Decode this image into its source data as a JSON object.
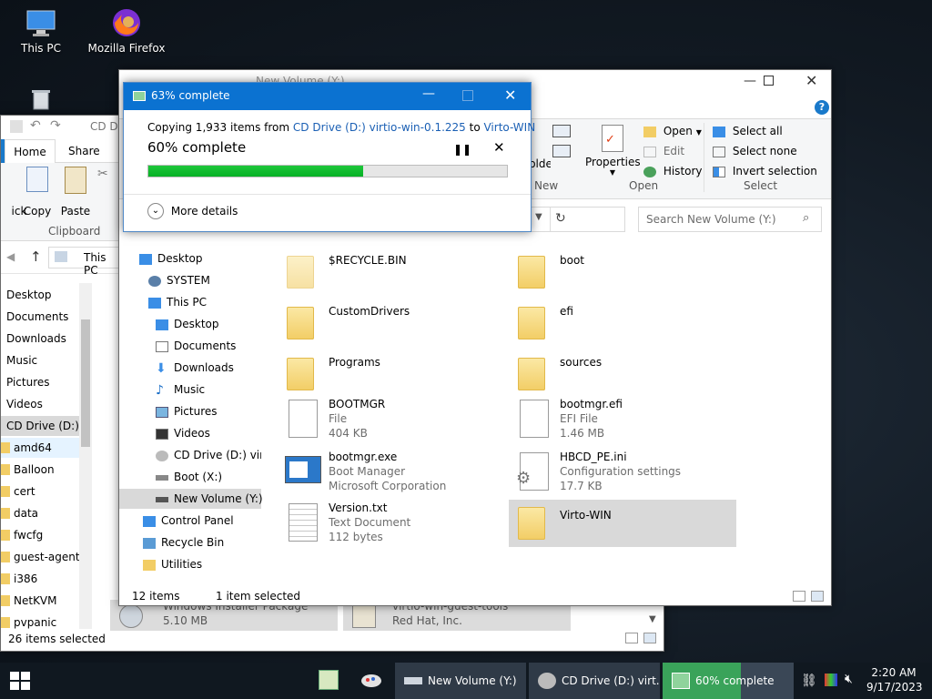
{
  "desktop": {
    "icons": [
      {
        "label": "This PC"
      },
      {
        "label": "Mozilla Firefox"
      }
    ]
  },
  "back_explorer": {
    "title": "CD Dr",
    "tabs": [
      "Home",
      "Share"
    ],
    "ribbon_buttons": [
      "ick",
      "Copy",
      "Paste"
    ],
    "ribbon_group": "Clipboard",
    "address": "This PC",
    "nav_items": [
      "Desktop",
      "Documents",
      "Downloads",
      "Music",
      "Pictures",
      "Videos",
      "CD Drive (D:) v",
      "amd64",
      "Balloon",
      "cert",
      "data",
      "fwcfg",
      "guest-agent",
      "i386",
      "NetKVM",
      "pvpanic"
    ],
    "partial_files": [
      {
        "line1": "Windows Installer Package",
        "line2": "5.10 MB"
      },
      {
        "line1": "virtio-win-guest-tools",
        "line2": "Red Hat, Inc."
      }
    ],
    "status": "26 items selected"
  },
  "main_explorer": {
    "title": "New Volume (Y:)",
    "ribbon": {
      "new_group_label": "New",
      "new_folder": "New folder",
      "properties": "Properties",
      "open": "Open",
      "edit": "Edit",
      "history": "History",
      "open_group": "Open",
      "select_all": "Select all",
      "select_none": "Select none",
      "invert_selection": "Invert selection",
      "select_group": "Select"
    },
    "search_placeholder": "Search New Volume (Y:)",
    "nav_items": [
      "Desktop",
      "SYSTEM",
      "This PC",
      "Desktop",
      "Documents",
      "Downloads",
      "Music",
      "Pictures",
      "Videos",
      "CD Drive (D:) virtio",
      "Boot (X:)",
      "New Volume (Y:)",
      "Control Panel",
      "Recycle Bin",
      "Utilities"
    ],
    "files": [
      {
        "name": "$RECYCLE.BIN",
        "type": "",
        "size": ""
      },
      {
        "name": "boot",
        "type": "",
        "size": ""
      },
      {
        "name": "CustomDrivers",
        "type": "",
        "size": ""
      },
      {
        "name": "efi",
        "type": "",
        "size": ""
      },
      {
        "name": "Programs",
        "type": "",
        "size": ""
      },
      {
        "name": "sources",
        "type": "",
        "size": ""
      },
      {
        "name": "BOOTMGR",
        "type": "File",
        "size": "404 KB"
      },
      {
        "name": "bootmgr.efi",
        "type": "EFI File",
        "size": "1.46 MB"
      },
      {
        "name": "bootmgr.exe",
        "type": "Boot Manager",
        "size": "Microsoft Corporation"
      },
      {
        "name": "HBCD_PE.ini",
        "type": "Configuration settings",
        "size": "17.7 KB"
      },
      {
        "name": "Version.txt",
        "type": "Text Document",
        "size": "112 bytes"
      },
      {
        "name": "Virto-WIN",
        "type": "",
        "size": ""
      }
    ],
    "status_count": "12 items",
    "status_selected": "1 item selected"
  },
  "copy_dialog": {
    "title": "63% complete",
    "copy_prefix": "Copying 1,933 items from ",
    "source": "CD Drive (D:) virtio-win-0.1.225",
    "to": " to ",
    "destination": "Virto-WIN",
    "percent_text": "60% complete",
    "progress_fraction": 0.6,
    "more_details": "More details",
    "accent_color": "#06b025"
  },
  "taskbar": {
    "buttons": [
      {
        "label": "New Volume (Y:)"
      },
      {
        "label": "CD Drive (D:) virt..."
      },
      {
        "label": "60% complete"
      }
    ],
    "time": "2:20 AM",
    "date": "9/17/2023"
  }
}
